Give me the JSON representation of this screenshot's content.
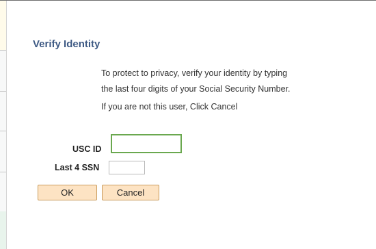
{
  "dialog": {
    "title": "Verify Identity",
    "message_line1": "To protect to privacy, verify your identity by typing",
    "message_line2": "the last four digits of your Social Security Number.",
    "cancel_hint": "If you are not this user, Click Cancel"
  },
  "form": {
    "usc_id": {
      "label": "USC ID",
      "value": "",
      "placeholder": ""
    },
    "ssn_last4": {
      "label": "Last 4 SSN",
      "value": "",
      "placeholder": ""
    }
  },
  "buttons": {
    "ok_label": "OK",
    "cancel_label": "Cancel"
  },
  "colors": {
    "title": "#3e5a84",
    "focus_border": "#6aa84f",
    "button_bg": "#fde3c3",
    "button_border": "#c99b5c"
  }
}
